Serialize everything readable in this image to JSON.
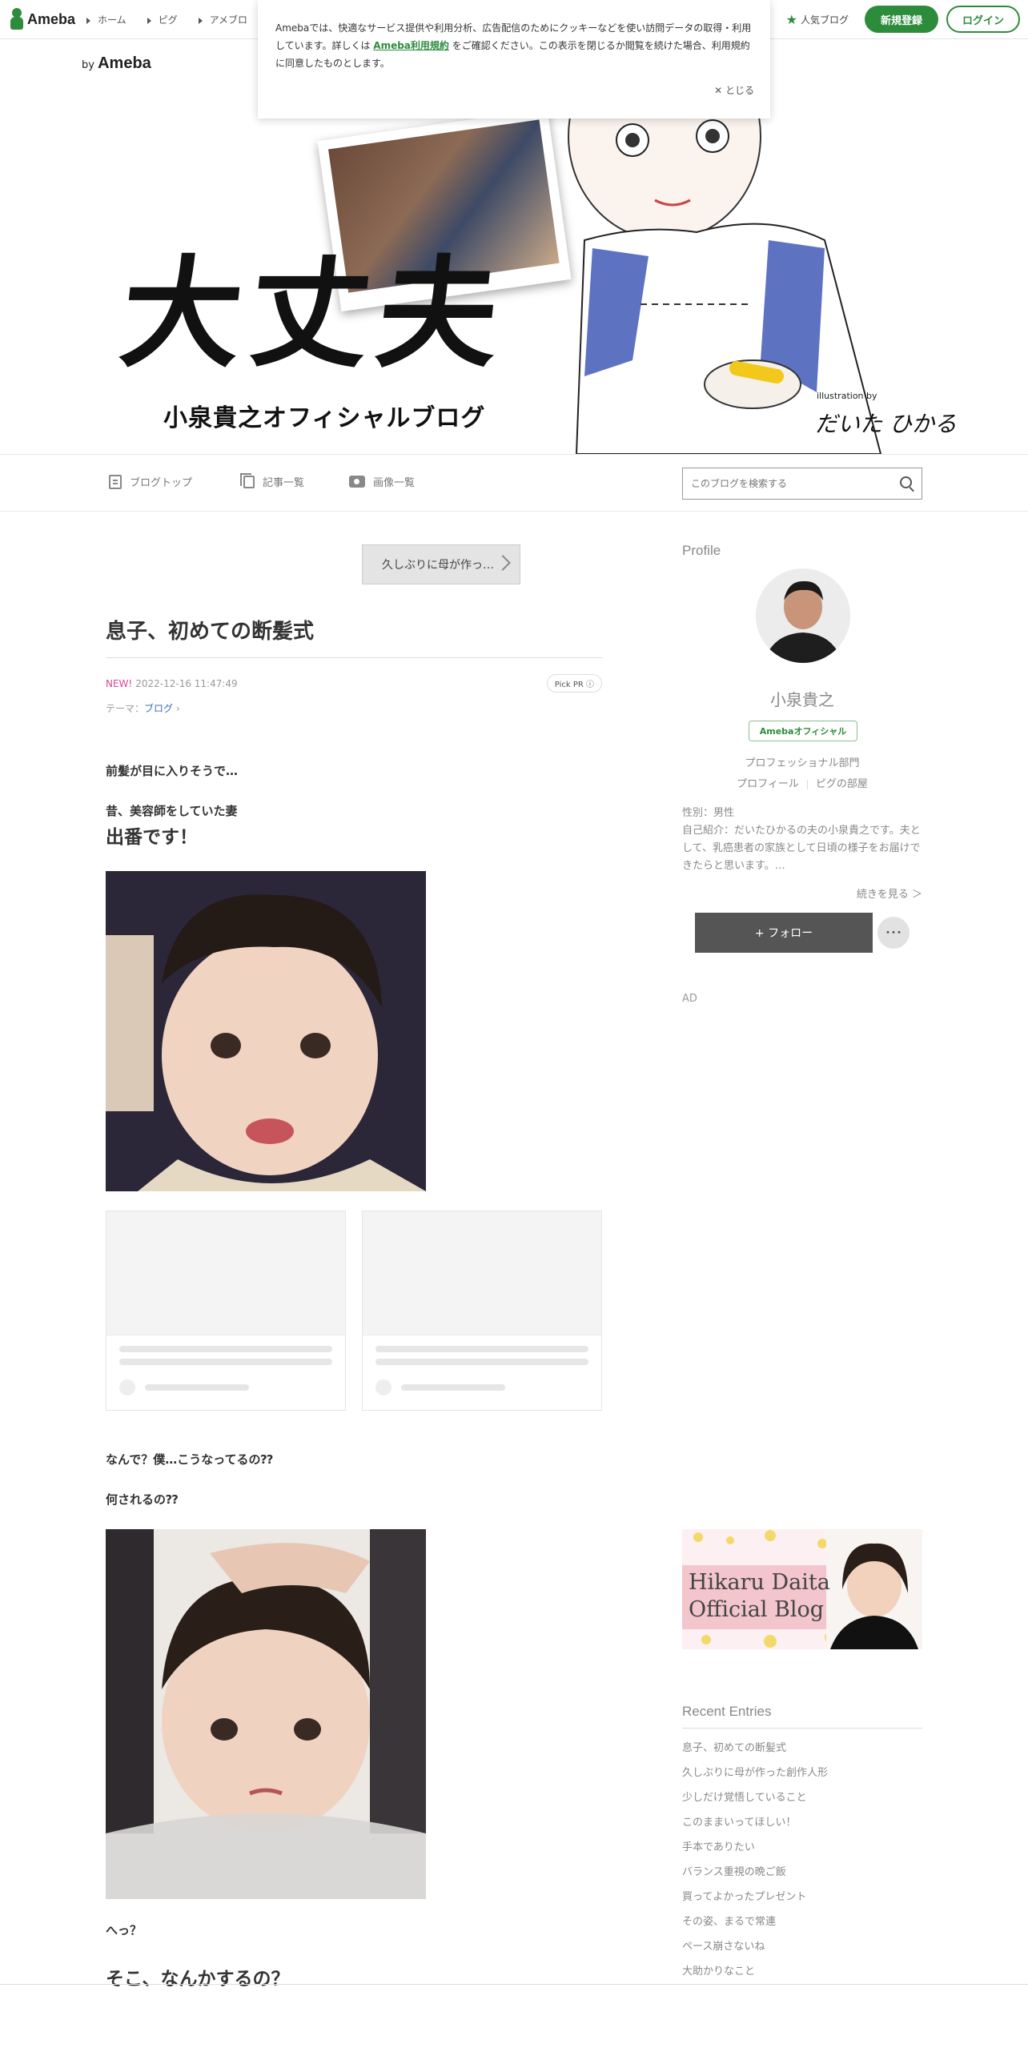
{
  "global_header": {
    "logo_text": "Ameba",
    "nav": [
      "ホーム",
      "ピグ",
      "アメブロ"
    ],
    "popular": "人気ブログ",
    "register": "新規登録",
    "login": "ログイン"
  },
  "cookie_notice": {
    "text_before": "Amebaでは、快適なサービス提供や利用分析、広告配信のためにクッキーなどを使い訪問データの取得・利用しています。詳しくは",
    "link": "Ameba利用規約",
    "text_after": "をご確認ください。この表示を閉じるか閲覧を続けた場合、利用規約に同意したものとします。",
    "close": "とじる"
  },
  "banner": {
    "by": "by",
    "brand": "Ameba",
    "title": "大丈夫",
    "subtitle": "小泉貴之オフィシャルブログ",
    "illustration_by": "illustration by",
    "illustrator": "だいた ひかる"
  },
  "blog_nav": {
    "items": [
      "ブログトップ",
      "記事一覧",
      "画像一覧"
    ],
    "search_placeholder": "このブログを検索する"
  },
  "entry": {
    "prev_label": "久しぶりに母が作っ…",
    "title": "息子、初めての断髪式",
    "new_badge": "NEW!",
    "date": "2022-12-16 11:47:49",
    "pick_pr": "Pick PR ⓘ",
    "theme_label": "テーマ：",
    "theme": "ブログ",
    "paragraphs": [
      "前髪が目に入りそうで…",
      "昔、美容師をしていた妻",
      "出番です！",
      "なんで？僕…こうなってるの⁇",
      "何されるの⁇",
      "へっ？",
      "そこ、なんかするの？"
    ]
  },
  "profile": {
    "heading": "Profile",
    "name": "小泉貴之",
    "badge": "Amebaオフィシャル",
    "category": "プロフェッショナル部門",
    "link_profile": "プロフィール",
    "link_pig": "ピグの部屋",
    "gender": "性別：男性",
    "intro": "自己紹介：だいたひかるの夫の小泉貴之です。夫として、乳癌患者の家族として日頃の様子をお届けできたらと思います。…",
    "more": "続きを見る ＞",
    "follow": "+ フォロー",
    "menu": "･･･",
    "ad": "AD"
  },
  "side_banner": {
    "line1": "Hikaru Daita",
    "line2": "Official Blog"
  },
  "recent": {
    "heading": "Recent Entries",
    "items": [
      "息子、初めての断髪式",
      "久しぶりに母が作った創作人形",
      "少しだけ覚悟していること",
      "このままいってほしい！",
      "手本でありたい",
      "バランス重視の晩ご飯",
      "買ってよかったプレゼント",
      "その姿、まるで常連",
      "ペース崩さないね",
      "大助かりなこと"
    ]
  },
  "colors": {
    "brand_green": "#2d8c3c",
    "new_pink": "#d64896",
    "follow_bg": "#555555"
  }
}
